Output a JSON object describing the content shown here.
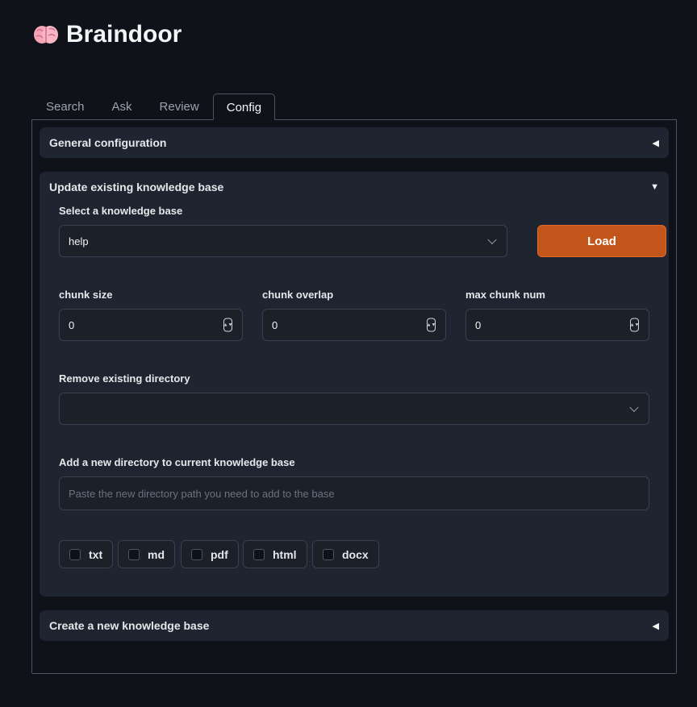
{
  "app": {
    "title": "Braindoor",
    "logo_icon": "brain-icon"
  },
  "tabs": [
    {
      "label": "Search",
      "active": false
    },
    {
      "label": "Ask",
      "active": false
    },
    {
      "label": "Review",
      "active": false
    },
    {
      "label": "Config",
      "active": true
    }
  ],
  "general": {
    "title": "General configuration",
    "state": "collapsed"
  },
  "update": {
    "title": "Update existing knowledge base",
    "state": "expanded",
    "select_kb": {
      "label": "Select a knowledge base",
      "value": "help"
    },
    "load_button": "Load",
    "chunk_size": {
      "label": "chunk size",
      "value": "0"
    },
    "chunk_overlap": {
      "label": "chunk overlap",
      "value": "0"
    },
    "max_chunk_num": {
      "label": "max chunk num",
      "value": "0"
    },
    "remove_dir": {
      "label": "Remove existing directory",
      "value": ""
    },
    "add_dir": {
      "label": "Add a new directory to current knowledge base",
      "placeholder": "Paste the new directory path you need to add to the base"
    },
    "filetypes": [
      {
        "label": "txt",
        "checked": false
      },
      {
        "label": "md",
        "checked": false
      },
      {
        "label": "pdf",
        "checked": false
      },
      {
        "label": "html",
        "checked": false
      },
      {
        "label": "docx",
        "checked": false
      }
    ]
  },
  "create": {
    "title": "Create a new knowledge base",
    "state": "collapsed"
  },
  "colors": {
    "accent": "#c2561a",
    "background": "#0f1218",
    "panel": "#1f2530"
  }
}
